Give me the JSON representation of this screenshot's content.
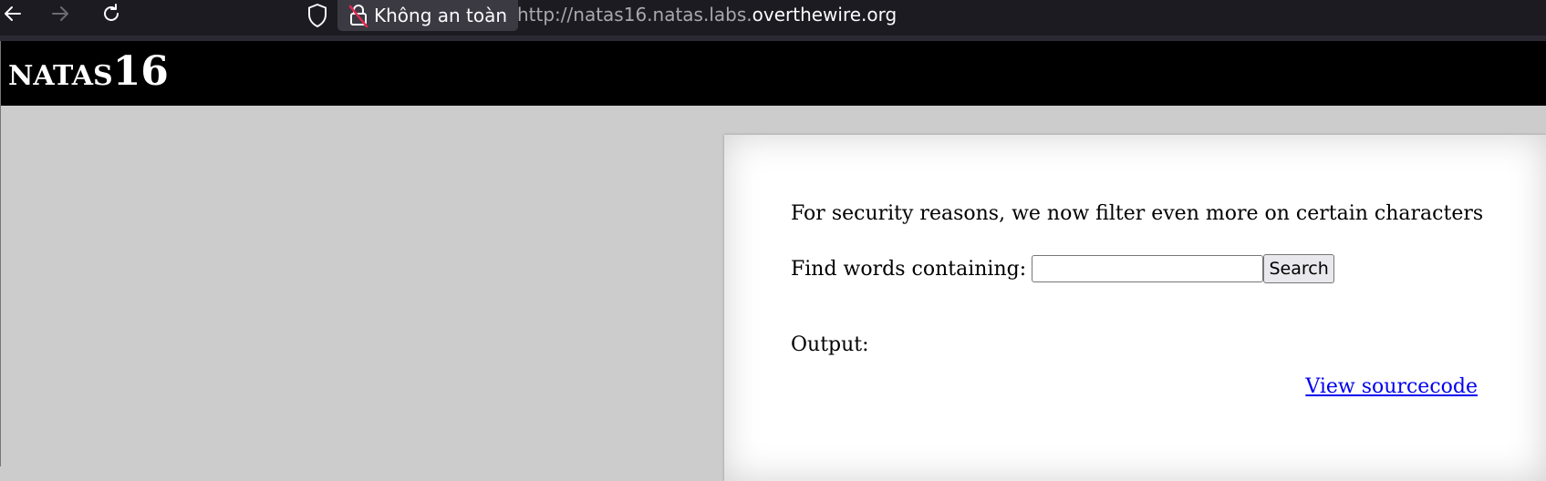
{
  "browser": {
    "site_info_label": "Không an toàn",
    "url_prefix": "http://natas16.natas.labs.",
    "url_domain": "overthewire.org"
  },
  "page": {
    "title_small": "NATAS",
    "title_num": "16",
    "intro_text": "For security reasons, we now filter even more on certain characters",
    "search_label": "Find words containing:",
    "search_value": "",
    "search_button": "Search",
    "output_label": "Output:",
    "view_source_link": "View sourcecode"
  },
  "colors": {
    "header_bg": "#000000",
    "page_bg": "#cccccc",
    "link": "#0000ee",
    "insecure_icon": "#e22850"
  }
}
